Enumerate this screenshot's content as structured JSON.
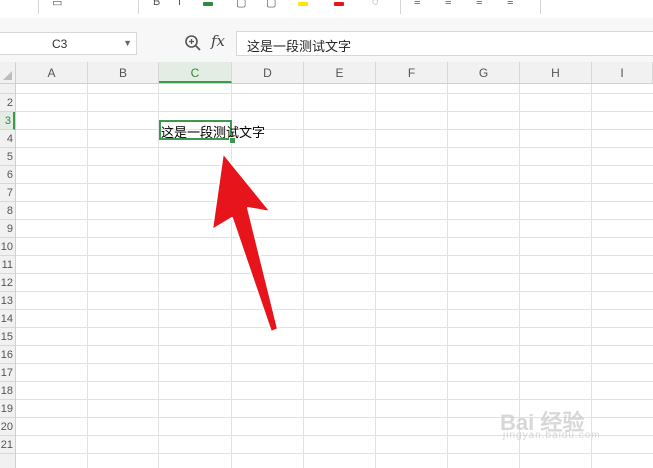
{
  "toolbar": {
    "items": [
      "",
      "",
      "",
      "",
      "",
      "",
      "",
      "",
      "",
      ""
    ],
    "menu_right_1": "",
    "menu_right_2": ""
  },
  "formula_bar": {
    "name_box": "C3",
    "fx_label": "fx",
    "formula": "这是一段测试文字"
  },
  "grid": {
    "columns": [
      "A",
      "B",
      "C",
      "D",
      "E",
      "F",
      "G",
      "H",
      "I"
    ],
    "active_column": "C",
    "rows": [
      "2",
      "3",
      "4",
      "5",
      "6",
      "7",
      "8",
      "9",
      "10",
      "11",
      "12",
      "13",
      "14",
      "15",
      "16",
      "17",
      "18",
      "19",
      "20",
      "21"
    ],
    "active_row": "3",
    "active_cell": "C3",
    "cell_c3_value": "这是一段测试文字"
  },
  "colors": {
    "accent_green": "#3c9a4e",
    "arrow_red": "#e8141c"
  },
  "watermark": {
    "text": "Bai 经验",
    "sub": "jingyan.baidu.com"
  }
}
